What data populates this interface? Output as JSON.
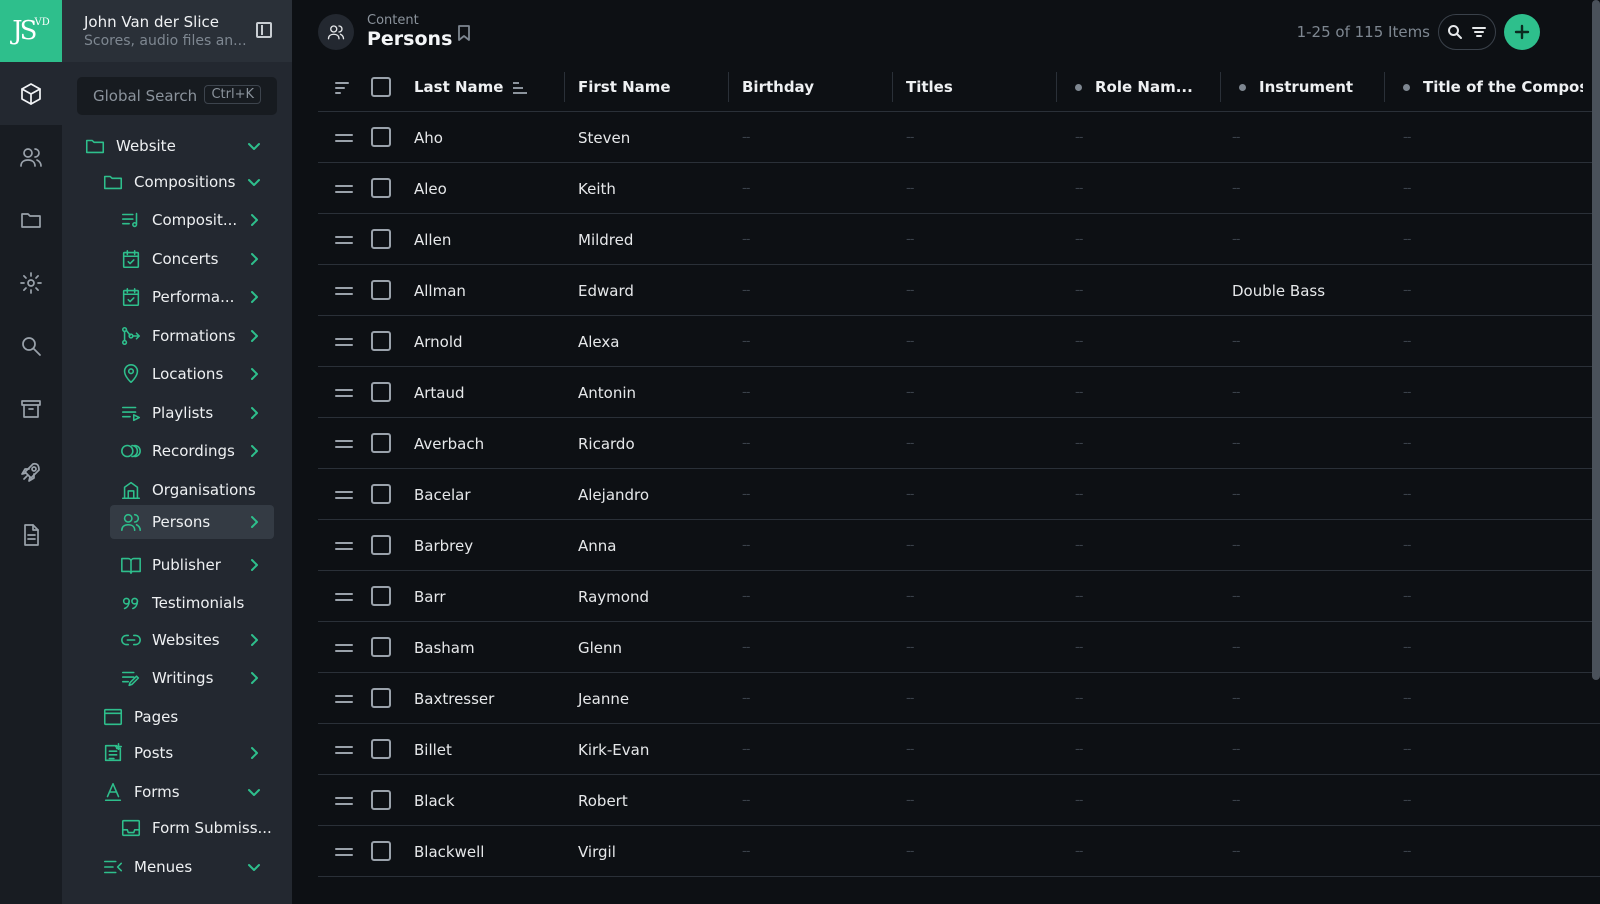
{
  "colors": {
    "accent": "#2ebf8c",
    "background": "#0d1014",
    "sidebar": "#232830",
    "rail": "#181c22"
  },
  "logo": {
    "text": "JS",
    "superscript": "VD"
  },
  "rail": [
    {
      "icon": "box-icon",
      "active": true
    },
    {
      "icon": "users-icon"
    },
    {
      "icon": "folder-icon"
    },
    {
      "icon": "gear-icon"
    },
    {
      "icon": "search-icon"
    },
    {
      "icon": "archive-icon"
    },
    {
      "icon": "rocket-icon"
    },
    {
      "icon": "document-icon"
    }
  ],
  "project": {
    "name": "John Van der Slice",
    "subtitle": "Scores, audio files an..."
  },
  "search": {
    "label": "Global Search",
    "shortcut": "Ctrl+K"
  },
  "nav": {
    "website": "Website",
    "compositions": "Compositions",
    "composit": "Composit...",
    "concerts": "Concerts",
    "performa": "Performa...",
    "formations": "Formations",
    "locations": "Locations",
    "playlists": "Playlists",
    "recordings": "Recordings",
    "organisations": "Organisations",
    "persons": "Persons",
    "publisher": "Publisher",
    "testimonials": "Testimonials",
    "websites": "Websites",
    "writings": "Writings",
    "pages": "Pages",
    "posts": "Posts",
    "forms": "Forms",
    "form_submiss": "Form Submiss...",
    "menues": "Menues"
  },
  "header": {
    "breadcrumb": "Content",
    "title": "Persons",
    "count": "1-25 of 115 Items"
  },
  "columns": [
    "Last Name",
    "First Name",
    "Birthday",
    "Titles",
    "Role Nam...",
    "Instrument",
    "Title of the Composit"
  ],
  "empty_cell": "--",
  "rows": [
    {
      "last": "Aho",
      "first": "Steven",
      "instrument": ""
    },
    {
      "last": "Aleo",
      "first": "Keith",
      "instrument": ""
    },
    {
      "last": "Allen",
      "first": "Mildred",
      "instrument": ""
    },
    {
      "last": "Allman",
      "first": "Edward",
      "instrument": "Double Bass"
    },
    {
      "last": "Arnold",
      "first": "Alexa",
      "instrument": ""
    },
    {
      "last": "Artaud",
      "first": "Antonin",
      "instrument": ""
    },
    {
      "last": "Averbach",
      "first": "Ricardo",
      "instrument": ""
    },
    {
      "last": "Bacelar",
      "first": "Alejandro",
      "instrument": ""
    },
    {
      "last": "Barbrey",
      "first": "Anna",
      "instrument": ""
    },
    {
      "last": "Barr",
      "first": "Raymond",
      "instrument": ""
    },
    {
      "last": "Basham",
      "first": "Glenn",
      "instrument": ""
    },
    {
      "last": "Baxtresser",
      "first": "Jeanne",
      "instrument": ""
    },
    {
      "last": "Billet",
      "first": "Kirk-Evan",
      "instrument": ""
    },
    {
      "last": "Black",
      "first": "Robert",
      "instrument": ""
    },
    {
      "last": "Blackwell",
      "first": "Virgil",
      "instrument": ""
    }
  ]
}
